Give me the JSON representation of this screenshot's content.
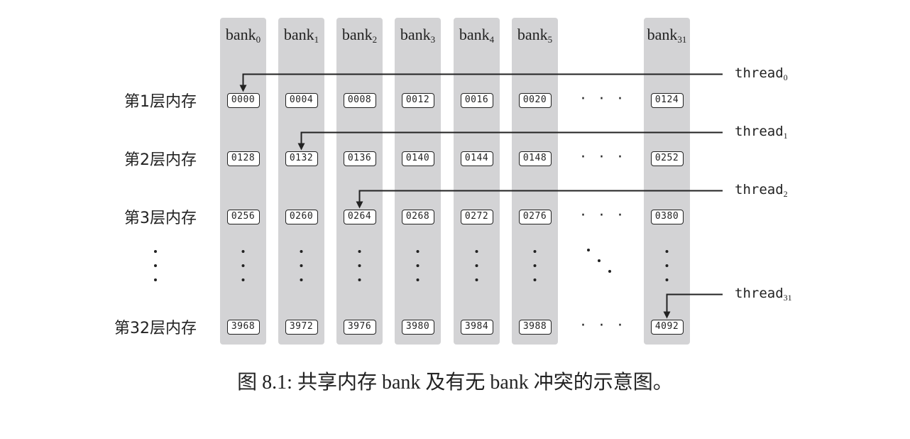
{
  "banks": [
    {
      "name": "bank",
      "sub": "0"
    },
    {
      "name": "bank",
      "sub": "1"
    },
    {
      "name": "bank",
      "sub": "2"
    },
    {
      "name": "bank",
      "sub": "3"
    },
    {
      "name": "bank",
      "sub": "4"
    },
    {
      "name": "bank",
      "sub": "5"
    },
    {
      "name": "bank",
      "sub": "31"
    }
  ],
  "rows": [
    {
      "label": "第1层内存",
      "cells": [
        "0000",
        "0004",
        "0008",
        "0012",
        "0016",
        "0020",
        "0124"
      ]
    },
    {
      "label": "第2层内存",
      "cells": [
        "0128",
        "0132",
        "0136",
        "0140",
        "0144",
        "0148",
        "0252"
      ]
    },
    {
      "label": "第3层内存",
      "cells": [
        "0256",
        "0260",
        "0264",
        "0268",
        "0272",
        "0276",
        "0380"
      ]
    },
    {
      "label": "第32层内存",
      "cells": [
        "3968",
        "3972",
        "3976",
        "3980",
        "3984",
        "3988",
        "4092"
      ]
    }
  ],
  "threads": [
    {
      "name": "thread",
      "sub": "0",
      "row": 0,
      "bank": 0
    },
    {
      "name": "thread",
      "sub": "1",
      "row": 1,
      "bank": 1
    },
    {
      "name": "thread",
      "sub": "2",
      "row": 2,
      "bank": 2
    },
    {
      "name": "thread",
      "sub": "31",
      "row": 3,
      "bank": 6
    }
  ],
  "caption": "图 8.1: 共享内存 bank 及有无 bank 冲突的示意图。"
}
